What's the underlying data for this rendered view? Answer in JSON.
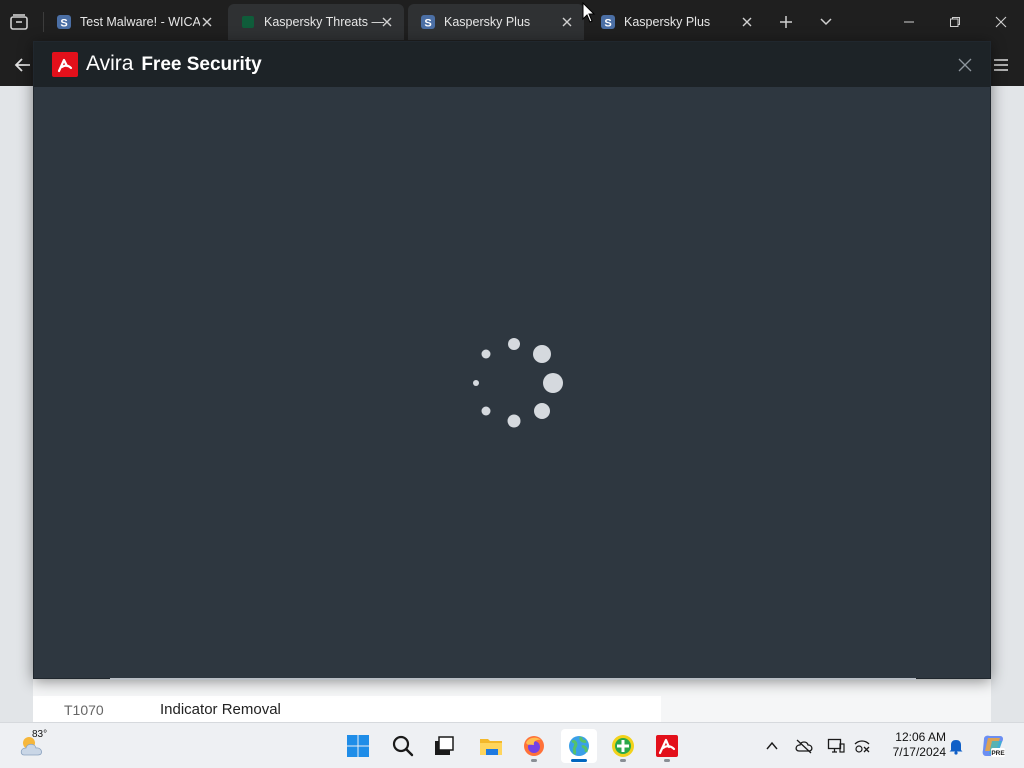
{
  "browser": {
    "tabs": [
      {
        "title": "Test Malware! - WICAR",
        "favicon": "s-letter-icon",
        "active": false
      },
      {
        "title": "Kaspersky Threats — T",
        "favicon": "kaspersky-icon",
        "active": true
      },
      {
        "title": "Kaspersky Plus",
        "favicon": "s-letter-icon",
        "active": false
      },
      {
        "title": "Kaspersky Plus",
        "favicon": "s-letter-icon",
        "active": false
      }
    ],
    "favicon_letter": "S"
  },
  "avira": {
    "brand": "Avira",
    "product": "Free Security",
    "accent": "#e3101b",
    "state": "loading"
  },
  "page_behind": {
    "row_code": "T1070",
    "row_name": "Indicator Removal"
  },
  "taskbar": {
    "weather_temp": "83°",
    "apps": [
      "windows-start",
      "search",
      "task-view",
      "file-explorer",
      "firefox",
      "globe-browser",
      "plus-app",
      "avira"
    ],
    "pre_badge": "PRE",
    "clock_time": "12:06 AM",
    "clock_date": "7/17/2024"
  }
}
